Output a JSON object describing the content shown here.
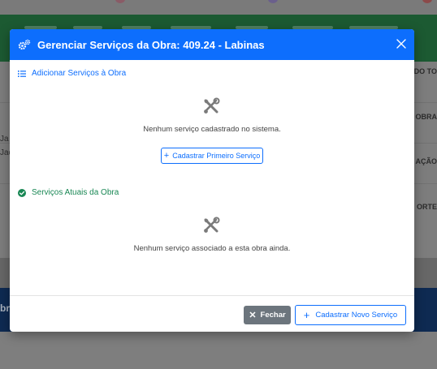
{
  "background": {
    "table_headers": [
      "DO TO",
      "OBRA",
      "AÇÃO",
      "ORTE"
    ],
    "row_fragments": [
      "Ja",
      "Jac"
    ],
    "footer_fragment": "bra"
  },
  "modal": {
    "title": "Gerenciar Serviços da Obra: 409.24 - Labinas",
    "close_icon": "close-icon",
    "add_section": {
      "title": "Adicionar Serviços à Obra",
      "icon": "list-icon",
      "empty_icon": "tools-icon",
      "empty_text": "Nenhum serviço cadastrado no sistema.",
      "button_label": "Cadastrar Primeiro Serviço"
    },
    "current_section": {
      "title": "Serviços Atuais da Obra",
      "icon": "check-circle-icon",
      "empty_icon": "tools-icon",
      "empty_text": "Nenhum serviço associado a esta obra ainda."
    },
    "footer": {
      "close_label": "Fechar",
      "new_service_label": "Cadastrar Novo Serviço"
    }
  },
  "colors": {
    "primary": "#0d6efd",
    "success": "#198754",
    "secondary": "#6c757d"
  }
}
